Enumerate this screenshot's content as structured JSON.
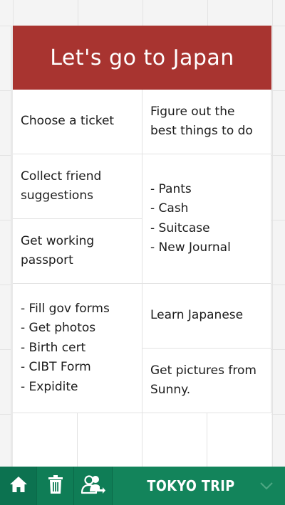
{
  "board": {
    "title": "Let's go to Japan"
  },
  "cards": [
    {
      "id": "choose-ticket",
      "text": "Choose a ticket"
    },
    {
      "id": "best-things",
      "text": "Figure out the\nbest things to do"
    },
    {
      "id": "friend-suggestions",
      "text": "Collect friend\nsuggestions"
    },
    {
      "id": "packing-list",
      "text": "- Pants\n- Cash\n- Suitcase\n- New Journal"
    },
    {
      "id": "working-passport",
      "text": "Get working\npassport"
    },
    {
      "id": "passport-tasks",
      "text": "- Fill gov forms\n- Get photos\n- Birth cert\n- CIBT Form\n- Expidite"
    },
    {
      "id": "learn-japanese",
      "text": "Learn Japanese"
    },
    {
      "id": "pictures-sunny",
      "text": "Get pictures from\nSunny."
    }
  ],
  "toolbar": {
    "board_name": "TOKYO TRIP",
    "icons": [
      "home-icon",
      "trash-icon",
      "share-users-icon",
      "chevron-down-icon"
    ]
  },
  "colors": {
    "header": "#a83430",
    "toolbar": "#0e7a54"
  }
}
